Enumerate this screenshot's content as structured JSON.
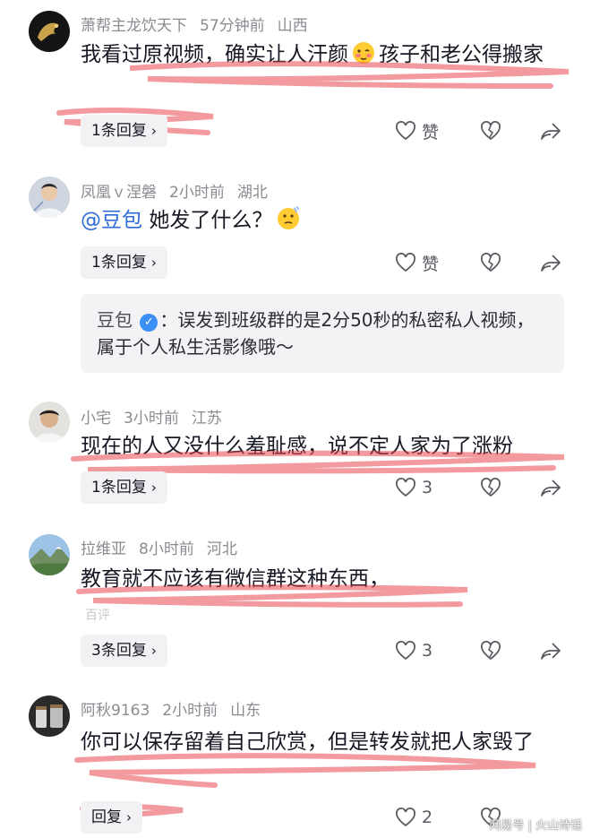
{
  "comments": [
    {
      "user": "萧帮主龙饮天下",
      "time": "57分钟前",
      "location": "山西",
      "text_before_emoji": "我看过原视频，确实让人汗颜",
      "text_after_emoji": "孩子和老公得搬家",
      "emoji": "blushing-face",
      "reply_label": "1条回复",
      "like_label": "赞"
    },
    {
      "user": "凤凰ｖ涅磐",
      "time": "2小时前",
      "location": "湖北",
      "mention": "@豆包",
      "text": "她发了什么？",
      "emoji": "thinking-face",
      "reply_label": "1条回复",
      "like_label": "赞",
      "quote": {
        "name": "豆包",
        "badge_icon": "verified-check",
        "text": "：误发到班级群的是2分50秒的私密私人视频，属于个人私生活影像哦～"
      }
    },
    {
      "user": "小宅",
      "time": "3小时前",
      "location": "江苏",
      "text": "现在的人又没什么羞耻感，说不定人家为了涨粉",
      "reply_label": "1条回复",
      "like_count": "3"
    },
    {
      "user": "拉维亚",
      "time": "8小时前",
      "location": "河北",
      "text": "教育就不应该有微信群这种东西，",
      "ghost_text": "百评",
      "reply_label": "3条回复",
      "like_count": "3"
    },
    {
      "user": "阿秋9163",
      "time": "2小时前",
      "location": "山东",
      "text": "你可以保存留着自己欣赏，但是转发就把人家毁了",
      "reply_label": "回复",
      "like_count": "2"
    }
  ],
  "watermark": "网易号 | 火山诗话",
  "colors": {
    "accent": "#2d6bd6",
    "underline": "#e8474f",
    "secondary": "#8a8b91"
  }
}
